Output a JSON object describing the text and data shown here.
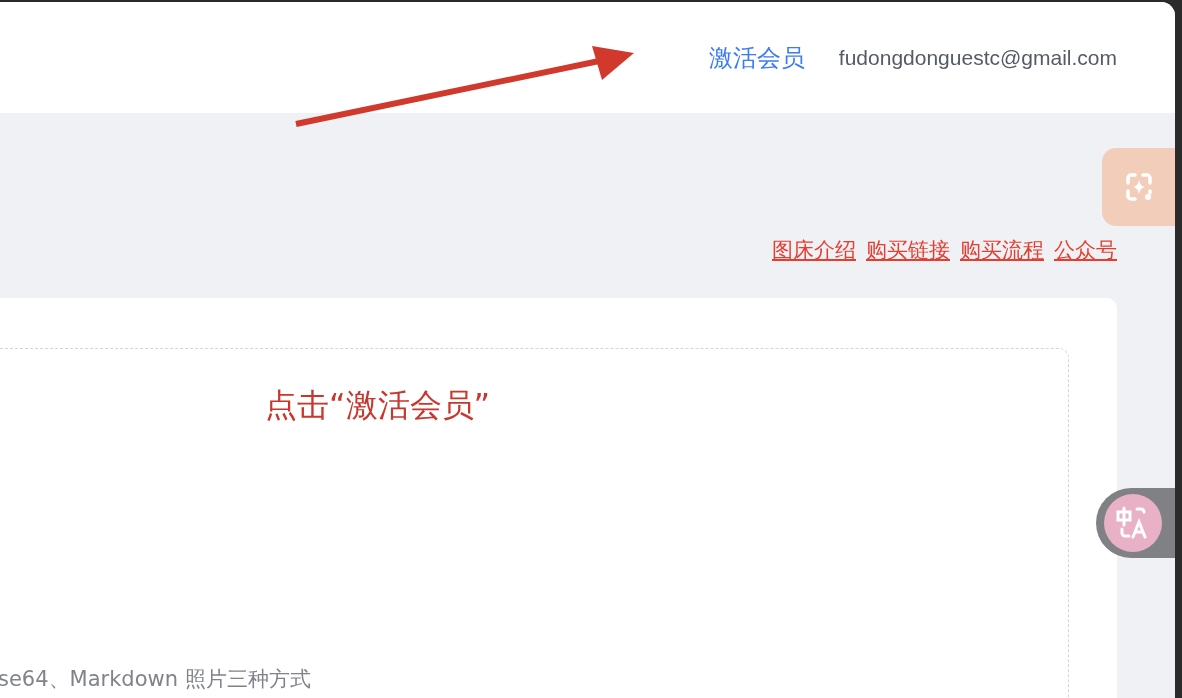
{
  "header": {
    "activate_link": "激活会员",
    "email": "fudongdonguestc@gmail.com"
  },
  "links": [
    "图床介绍",
    "购买链接",
    "购买流程",
    "公众号"
  ],
  "annotation": {
    "text": "点击“激活会员”"
  },
  "upload_area": {
    "hint": "se64、Markdown 照片三种方式"
  }
}
